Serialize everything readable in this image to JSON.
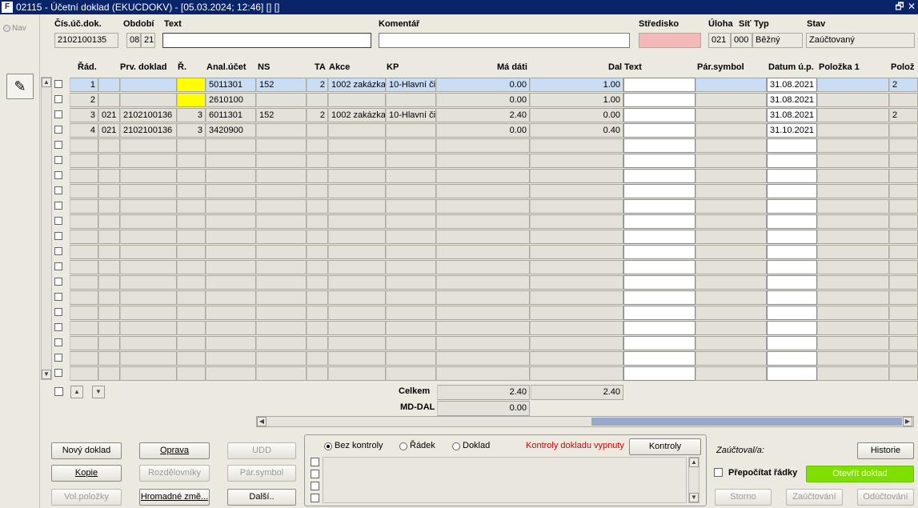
{
  "window": {
    "title": "02115 - Účetní doklad (EKUCDOKV) - [05.03.2024; 12:46] [] []",
    "app_icon": "oracle-forms-icon",
    "restore_glyph": "🗗",
    "close_glyph": "✕"
  },
  "nav": {
    "label": "Nav",
    "tool_icon": "✎"
  },
  "header": {
    "labels": {
      "cis_uc_dok": "Čís.úč.dok.",
      "obdobi": "Období",
      "text": "Text",
      "komentar": "Komentář",
      "stredisko": "Středisko",
      "uloha": "Úloha",
      "sit": "Síť",
      "typ": "Typ",
      "stav": "Stav"
    },
    "values": {
      "cis_uc_dok": "2102100135",
      "obdobi_month": "08",
      "obdobi_year": "21",
      "text": "",
      "komentar": "",
      "stredisko": "",
      "uloha": "021",
      "sit": "000",
      "typ": "Běžný",
      "stav": "Zaúčtovaný"
    }
  },
  "grid": {
    "columns": {
      "rad": "Řád.",
      "prv_doklad": "Prv. doklad",
      "r": "Ř.",
      "anal_ucet": "Anal.účet",
      "ns": "NS",
      "ta": "TA",
      "akce": "Akce",
      "kp": "KP",
      "ma_dati": "Má dáti",
      "dal": "Dal",
      "text": "Text",
      "par_symbol": "Pár.symbol",
      "datum_up": "Datum ú.p.",
      "polozka1": "Položka 1",
      "poloz": "Polož"
    },
    "rows": [
      {
        "rad": "1",
        "uloha": "",
        "prv_doklad": "",
        "r": "",
        "anal_ucet": "5011301",
        "ns": "152",
        "ta": "2",
        "akce": "1002 zakázka",
        "kp": "10-Hlavní či",
        "ma_dati": "0.00",
        "dal": "1.00",
        "text": "",
        "par_symbol": "",
        "datum_up": "31.08.2021",
        "polozka1": "",
        "poloz": "2"
      },
      {
        "rad": "2",
        "uloha": "",
        "prv_doklad": "",
        "r": "",
        "anal_ucet": "2610100",
        "ns": "",
        "ta": "",
        "akce": "",
        "kp": "",
        "ma_dati": "0.00",
        "dal": "1.00",
        "text": "",
        "par_symbol": "",
        "datum_up": "31.08.2021",
        "polozka1": "",
        "poloz": ""
      },
      {
        "rad": "3",
        "uloha": "021",
        "prv_doklad": "2102100136",
        "r": "3",
        "anal_ucet": "6011301",
        "ns": "152",
        "ta": "2",
        "akce": "1002 zakázka",
        "kp": "10-Hlavní či",
        "ma_dati": "2.40",
        "dal": "0.00",
        "text": "",
        "par_symbol": "",
        "datum_up": "31.08.2021",
        "polozka1": "",
        "poloz": "2"
      },
      {
        "rad": "4",
        "uloha": "021",
        "prv_doklad": "2102100136",
        "r": "3",
        "anal_ucet": "3420900",
        "ns": "",
        "ta": "",
        "akce": "",
        "kp": "",
        "ma_dati": "0.00",
        "dal": "0.40",
        "text": "",
        "par_symbol": "",
        "datum_up": "31.10.2021",
        "polozka1": "",
        "poloz": ""
      }
    ]
  },
  "totals": {
    "celkem_label": "Celkem",
    "celkem_ma_dati": "2.40",
    "celkem_dal": "2.40",
    "md_dal_label": "MD-DAL",
    "md_dal_value": "0.00"
  },
  "buttons": {
    "novy_doklad": "Nový doklad",
    "oprava": "Oprava",
    "udd": "UDD",
    "kopie": "Kopie",
    "rozdelovniky": "Rozdělovníky",
    "par_symbol": "Pár.symbol",
    "vol_polozky": "Vol.položky",
    "hromadne": "Hromadné změ...",
    "dalsi": "Další..",
    "kontroly": "Kontroly",
    "historie": "Historie",
    "otevrit_doklad": "Otevřít doklad",
    "storno": "Storno",
    "zauctovani": "Zaúčtování",
    "oductovani": "Odúčtování"
  },
  "kontroly": {
    "bez_kontroly": "Bez kontroly",
    "radek": "Řádek",
    "doklad": "Doklad",
    "selected": "bez_kontroly",
    "status": "Kontroly dokladu vypnuty"
  },
  "right_panel": {
    "zauctoval_label": "Zaúčtoval/a:",
    "prepocitat": "Přepočítat řádky"
  },
  "colors": {
    "title_bar": "#0a246a",
    "selected_row": "#c9def5",
    "yellow_flag": "#ffff00",
    "otevrit_green": "#7fe000",
    "status_red": "#d10000"
  }
}
